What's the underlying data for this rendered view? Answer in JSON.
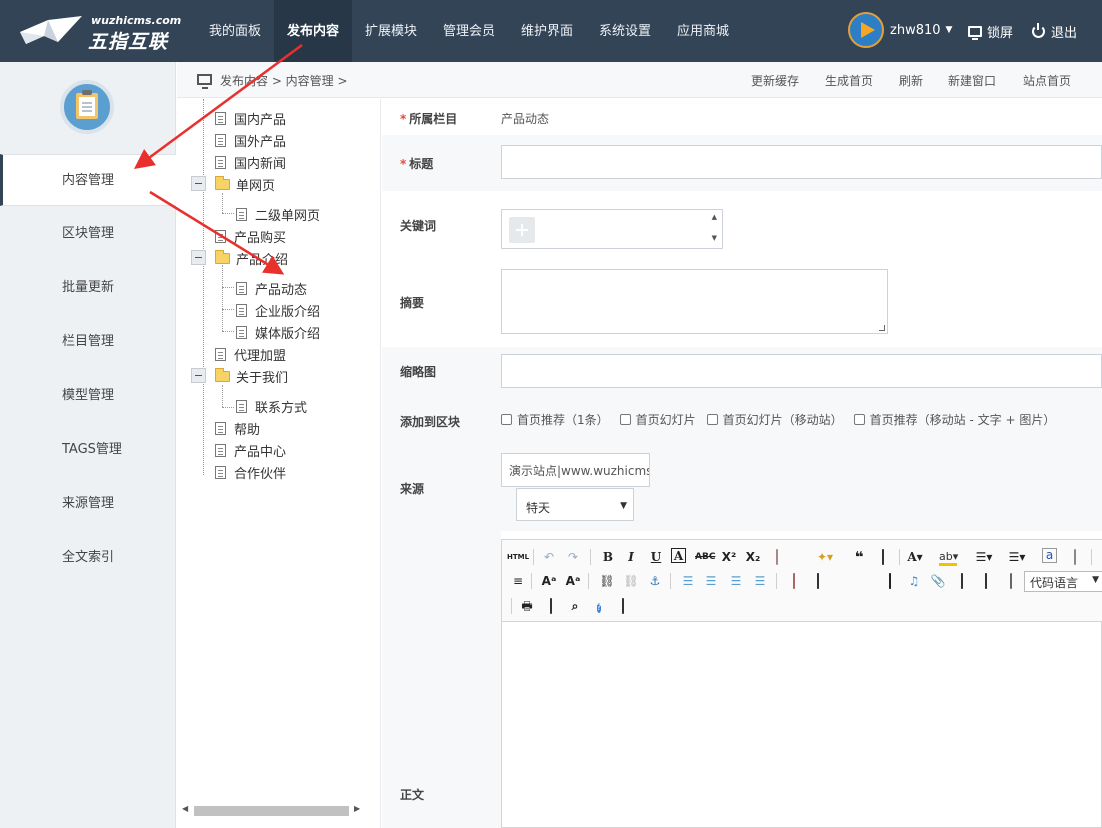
{
  "brand": {
    "sub": "wuzhicms.com",
    "main": "五指互联"
  },
  "nav": [
    "我的面板",
    "发布内容",
    "扩展模块",
    "管理会员",
    "维护界面",
    "系统设置",
    "应用商城"
  ],
  "user": {
    "name": "zhw810",
    "lock": "锁屏",
    "logout": "退出"
  },
  "sidebar": [
    "内容管理",
    "区块管理",
    "批量更新",
    "栏目管理",
    "模型管理",
    "TAGS管理",
    "来源管理",
    "全文索引"
  ],
  "breadcrumb": {
    "path": "发布内容 > 内容管理 >",
    "actions": [
      "更新缓存",
      "生成首页",
      "刷新",
      "新建窗口",
      "站点首页"
    ]
  },
  "tree": {
    "guonei": "国内产品",
    "guowai": "国外产品",
    "news": "国内新闻",
    "single": "单网页",
    "single_sub": "二级单网页",
    "buy": "产品购买",
    "intro": "产品介绍",
    "dynamic": "产品动态",
    "enterprise": "企业版介绍",
    "media": "媒体版介绍",
    "agent": "代理加盟",
    "about": "关于我们",
    "contact": "联系方式",
    "help": "帮助",
    "center": "产品中心",
    "partner": "合作伙伴"
  },
  "form": {
    "category_label": "所属栏目",
    "category_value": "产品动态",
    "title_label": "标题",
    "keywords_label": "关键词",
    "summary_label": "摘要",
    "thumb_label": "缩略图",
    "block_label": "添加到区块",
    "blocks": [
      "首页推荐（1条）",
      "首页幻灯片",
      "首页幻灯片（移动站）",
      "首页推荐（移动站 - 文字 + 图片）"
    ],
    "source_label": "来源",
    "source_value": "演示站点|www.wuzhicms.com",
    "source_select": "特天",
    "body_label": "正文",
    "code_language": "代码语言"
  },
  "editor_tools": [
    "html",
    "undo",
    "redo",
    "bold",
    "italic",
    "underline",
    "font-border",
    "strikethrough",
    "superscript",
    "subscript",
    "eraser",
    "format-brush",
    "auto-format",
    "blockquote",
    "paste-text",
    "font-color",
    "highlight-color",
    "ordered-list",
    "unordered-list",
    "spell",
    "page-break",
    "horizontal-rule",
    "to-uppercase",
    "to-lowercase",
    "link",
    "unlink",
    "anchor",
    "align-left",
    "align-center",
    "align-right",
    "align-justify",
    "image",
    "multi-image",
    "emotion",
    "scrawl",
    "video",
    "music",
    "attachment",
    "map",
    "gmap",
    "insert-code",
    "print",
    "preview",
    "search-replace",
    "help",
    "wordimage"
  ]
}
